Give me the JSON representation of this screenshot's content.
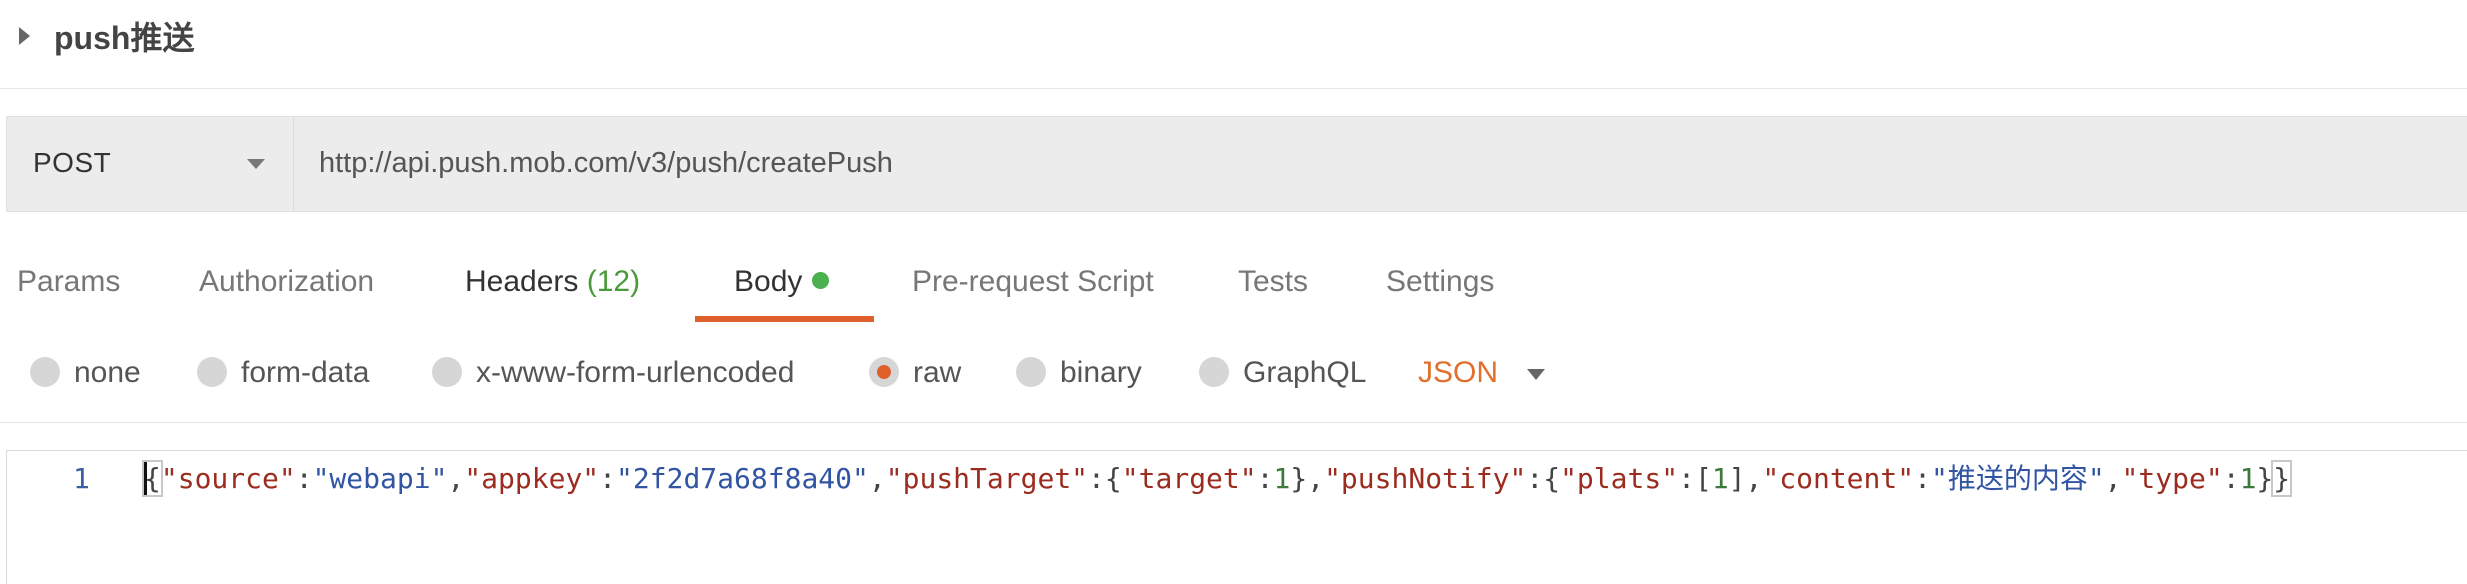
{
  "request": {
    "name": "push推送"
  },
  "url_bar": {
    "method": "POST",
    "url": "http://api.push.mob.com/v3/push/createPush"
  },
  "tabs": [
    {
      "label": "Params"
    },
    {
      "label": "Authorization"
    },
    {
      "label": "Headers",
      "count": "(12)"
    },
    {
      "label": "Body",
      "active": true,
      "indicator": "green-dot"
    },
    {
      "label": "Pre-request Script"
    },
    {
      "label": "Tests"
    },
    {
      "label": "Settings"
    }
  ],
  "body_types": {
    "options": [
      "none",
      "form-data",
      "x-www-form-urlencoded",
      "raw",
      "binary",
      "GraphQL"
    ],
    "selected": "raw",
    "language": "JSON"
  },
  "editor": {
    "line_number": "1",
    "tokens": {
      "t01": "{",
      "t02": "\"source\"",
      "t03": ":",
      "t04": "\"webapi\"",
      "t05": ",",
      "t06": "\"appkey\"",
      "t07": ":",
      "t08": "\"2f2d7a68f8a40\"",
      "t09": ",",
      "t10": "\"pushTarget\"",
      "t11": ":{",
      "t12": "\"target\"",
      "t13": ":",
      "t14": "1",
      "t15": "},",
      "t16": "\"pushNotify\"",
      "t17": ":{",
      "t18": "\"plats\"",
      "t19": ":[",
      "t20": "1",
      "t21": "],",
      "t22": "\"content\"",
      "t23": ":",
      "t24": "\"推送的内容\"",
      "t25": ",",
      "t26": "\"type\"",
      "t27": ":",
      "t28": "1",
      "t29": "}",
      "t30": "}"
    }
  },
  "colors": {
    "accent": "#e0602b",
    "active_dot": "#4caf50",
    "count_green": "#4a9a3a",
    "json_key": "#9b2c1f",
    "json_string": "#3155a3"
  }
}
